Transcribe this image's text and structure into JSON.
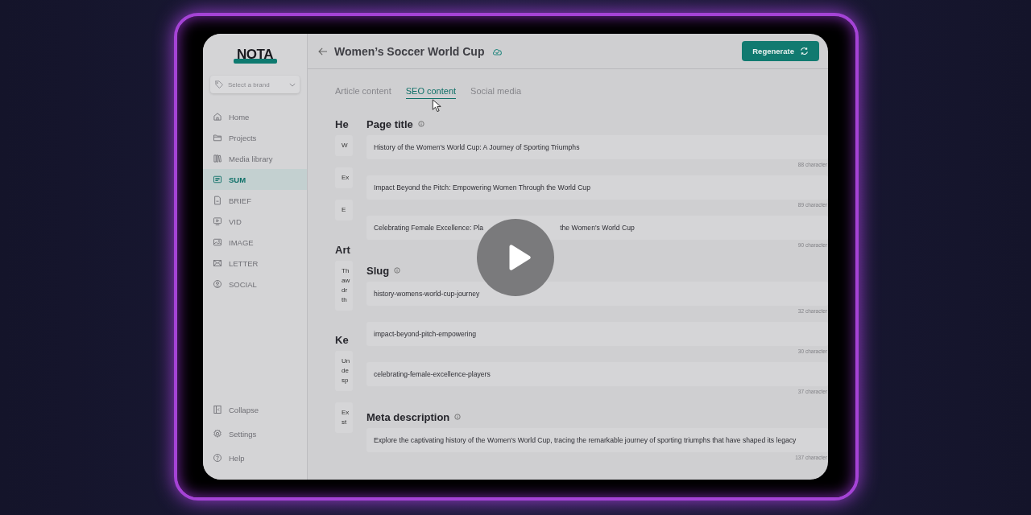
{
  "brand": {
    "logo": "NOTA",
    "select_placeholder": "Select a brand"
  },
  "sidebar": {
    "items": [
      {
        "label": "Home",
        "selected": false
      },
      {
        "label": "Projects",
        "selected": false
      },
      {
        "label": "Media library",
        "selected": false
      },
      {
        "label": "SUM",
        "selected": true
      },
      {
        "label": "BRIEF",
        "selected": false
      },
      {
        "label": "VID",
        "selected": false
      },
      {
        "label": "IMAGE",
        "selected": false
      },
      {
        "label": "LETTER",
        "selected": false
      },
      {
        "label": "SOCIAL",
        "selected": false
      }
    ],
    "bottom_items": [
      {
        "label": "Collapse"
      },
      {
        "label": "Settings"
      },
      {
        "label": "Help"
      }
    ]
  },
  "header": {
    "title": "Women’s Soccer World Cup",
    "button": "Regenerate"
  },
  "tabs": [
    {
      "label": "Article content",
      "selected": false
    },
    {
      "label": "SEO content",
      "selected": true
    },
    {
      "label": "Social media",
      "selected": false
    }
  ],
  "hidden_column": [
    {
      "kind": "heading",
      "lines": [
        "He"
      ]
    },
    {
      "kind": "card",
      "lines": [
        "W"
      ]
    },
    {
      "kind": "card",
      "lines": [
        "Ex"
      ]
    },
    {
      "kind": "card",
      "lines": [
        "E"
      ]
    },
    {
      "kind": "heading",
      "lines": [
        "Art"
      ]
    },
    {
      "kind": "card",
      "lines": [
        "Th",
        "aw",
        "dr",
        "th"
      ]
    },
    {
      "kind": "heading",
      "lines": [
        "Ke"
      ]
    },
    {
      "kind": "card",
      "lines": [
        "Un",
        "de",
        "sp"
      ]
    },
    {
      "kind": "card",
      "lines": [
        "Ex",
        "st"
      ]
    }
  ],
  "sections": [
    {
      "title": "Page title",
      "fields": [
        {
          "parts": [
            "History of the Women's World Cup: A Journey of Sporting Triumphs"
          ],
          "count": "88 character"
        },
        {
          "parts": [
            "Impact Beyond the Pitch: Empowering Women Through the World Cup"
          ],
          "count": "89 character"
        },
        {
          "parts": [
            "Celebrating Female Excellence: Pla",
            "the Women's World Cup"
          ],
          "count": "90 character"
        }
      ]
    },
    {
      "title": "Slug",
      "fields": [
        {
          "parts": [
            "history-womens-world-cup-journey"
          ],
          "count": "32 character"
        },
        {
          "parts": [
            "impact-beyond-pitch-empowering"
          ],
          "count": "30 character"
        },
        {
          "parts": [
            "celebrating-female-excellence-players"
          ],
          "count": "37 character"
        }
      ]
    },
    {
      "title": "Meta description",
      "fields": [
        {
          "parts": [
            "Explore the captivating history of the Women's World Cup, tracing the remarkable journey of sporting triumphs that have shaped its legacy"
          ],
          "count": "137 character"
        }
      ]
    }
  ]
}
